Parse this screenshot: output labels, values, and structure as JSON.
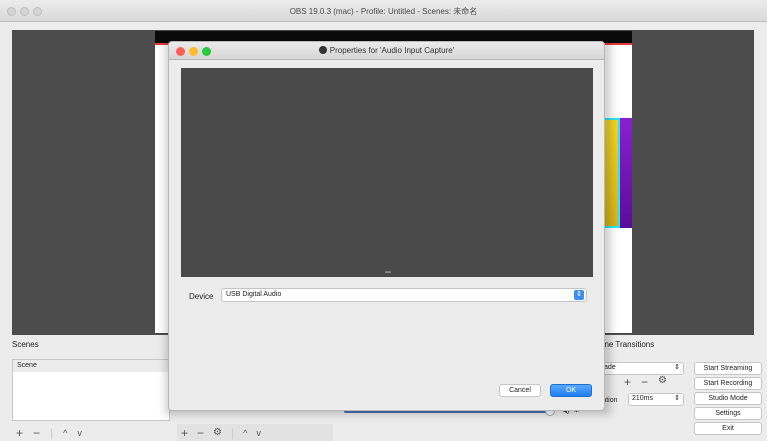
{
  "window": {
    "title": "OBS 19.0.3 (mac) - Profile: Untitled - Scenes: 未命名"
  },
  "scenes": {
    "label": "Scenes",
    "items": [
      "Scene"
    ],
    "add_icon": "plus-icon",
    "remove_icon": "minus-icon",
    "up_icon": "chevron-up-icon",
    "down_icon": "chevron-down-icon"
  },
  "sources": {
    "add_icon": "plus-icon",
    "remove_icon": "minus-icon",
    "settings_icon": "gear-icon",
    "up_icon": "chevron-up-icon",
    "down_icon": "chevron-down-icon"
  },
  "mixer": {
    "volume_icon": "speaker-icon",
    "settings_icon": "gear-icon"
  },
  "transitions": {
    "label": "ene Transitions",
    "selected": "ade",
    "duration_label": "ration",
    "duration_value": "210ms"
  },
  "controls": {
    "start_streaming": "Start Streaming",
    "start_recording": "Start Recording",
    "studio_mode": "Studio Mode",
    "settings": "Settings",
    "exit": "Exit"
  },
  "dialog": {
    "title": "Properties for 'Audio Input Capture'",
    "device_label": "Device",
    "device_value": "USB Digital Audio",
    "cancel_label": "Cancel",
    "ok_label": "OK"
  },
  "colors": {
    "accent": "#1f7ef5",
    "close": "#fc5f57",
    "minimize": "#fdbc2e",
    "zoom": "#29c940"
  }
}
